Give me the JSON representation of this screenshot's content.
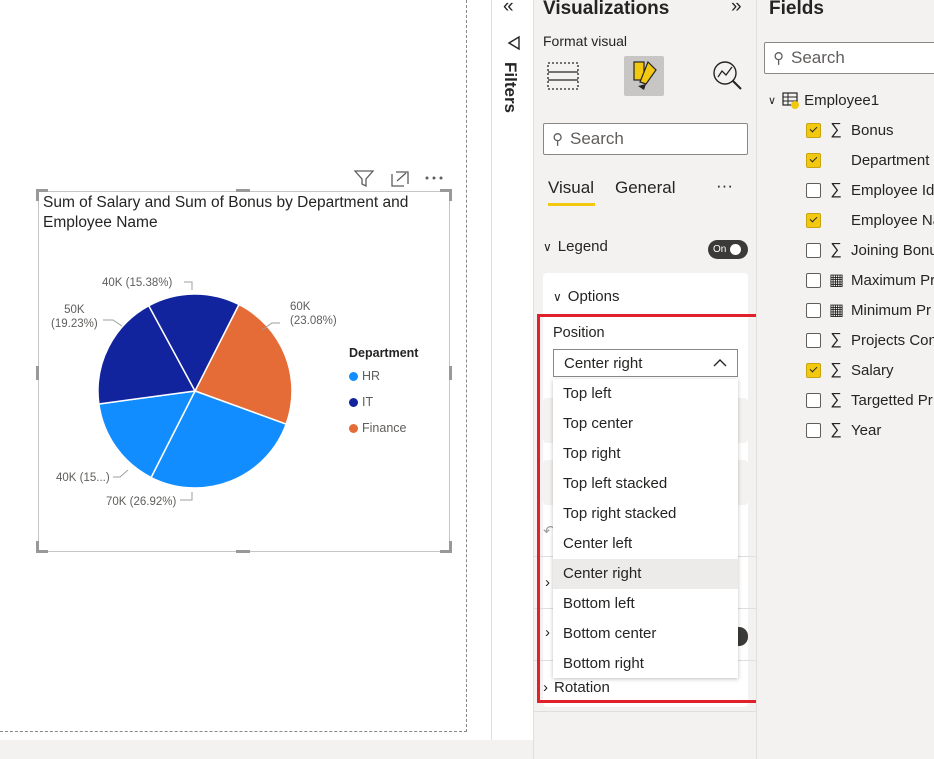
{
  "canvas": {
    "visual": {
      "title": "Sum of Salary and Sum of Bonus by Department and Employee Name",
      "header_icons": [
        "filter-icon",
        "focus-mode-icon",
        "more-options-icon"
      ]
    }
  },
  "chart_data": {
    "type": "pie",
    "title": "Sum of Salary and Sum of Bonus by Department and Employee Name",
    "legend_title": "Department",
    "legend_position": "center-right",
    "categories": [
      "HR",
      "IT",
      "Finance"
    ],
    "colors": {
      "HR": "#118dff",
      "IT": "#12239e",
      "Finance": "#e66c37"
    },
    "slices": [
      {
        "department": "Finance",
        "value": 60,
        "label": "60K",
        "percent_label": "(23.08%)",
        "color": "#e66c37"
      },
      {
        "department": "HR",
        "value": 70,
        "label": "70K (26.92%)",
        "color": "#118dff"
      },
      {
        "department": "HR",
        "value": 40,
        "label": "40K (15...)",
        "color": "#118dff"
      },
      {
        "department": "IT",
        "value": 50,
        "label": "50K",
        "percent_label": "(19.23%)",
        "color": "#12239e"
      },
      {
        "department": "IT",
        "value": 40,
        "label": "40K (15.38%)",
        "color": "#12239e"
      }
    ]
  },
  "filters": {
    "label": "Filters"
  },
  "visualizations": {
    "title": "Visualizations",
    "subtitle": "Format visual",
    "search_placeholder": "Search",
    "tabs": [
      "Visual",
      "General"
    ],
    "more_label": "···",
    "legend": {
      "label": "Legend",
      "toggle": "On"
    },
    "options": {
      "label": "Options"
    },
    "position": {
      "label": "Position",
      "selected": "Center right",
      "options": [
        "Top left",
        "Top center",
        "Top right",
        "Top left stacked",
        "Top right stacked",
        "Center left",
        "Center right",
        "Bottom left",
        "Bottom center",
        "Bottom right"
      ]
    },
    "rotation": {
      "label": "Rotation"
    },
    "highlight_color": "#e0202a"
  },
  "fields": {
    "title": "Fields",
    "search_placeholder": "Search",
    "table": "Employee1",
    "items": [
      {
        "label": "Bonus",
        "checked": true,
        "sigma": true
      },
      {
        "label": "Department",
        "checked": true,
        "sigma": false
      },
      {
        "label": "Employee Id",
        "checked": false,
        "sigma": true
      },
      {
        "label": "Employee Name",
        "checked": true,
        "sigma": false
      },
      {
        "label": "Joining Bonus",
        "checked": false,
        "sigma": true
      },
      {
        "label": "Maximum Pr",
        "checked": false,
        "sigma": false,
        "calc": true
      },
      {
        "label": "Minimum Pr",
        "checked": false,
        "sigma": false,
        "calc": true
      },
      {
        "label": "Projects Con",
        "checked": false,
        "sigma": true
      },
      {
        "label": "Salary",
        "checked": true,
        "sigma": true
      },
      {
        "label": "Targetted Pr",
        "checked": false,
        "sigma": true
      },
      {
        "label": "Year",
        "checked": false,
        "sigma": true
      }
    ]
  }
}
